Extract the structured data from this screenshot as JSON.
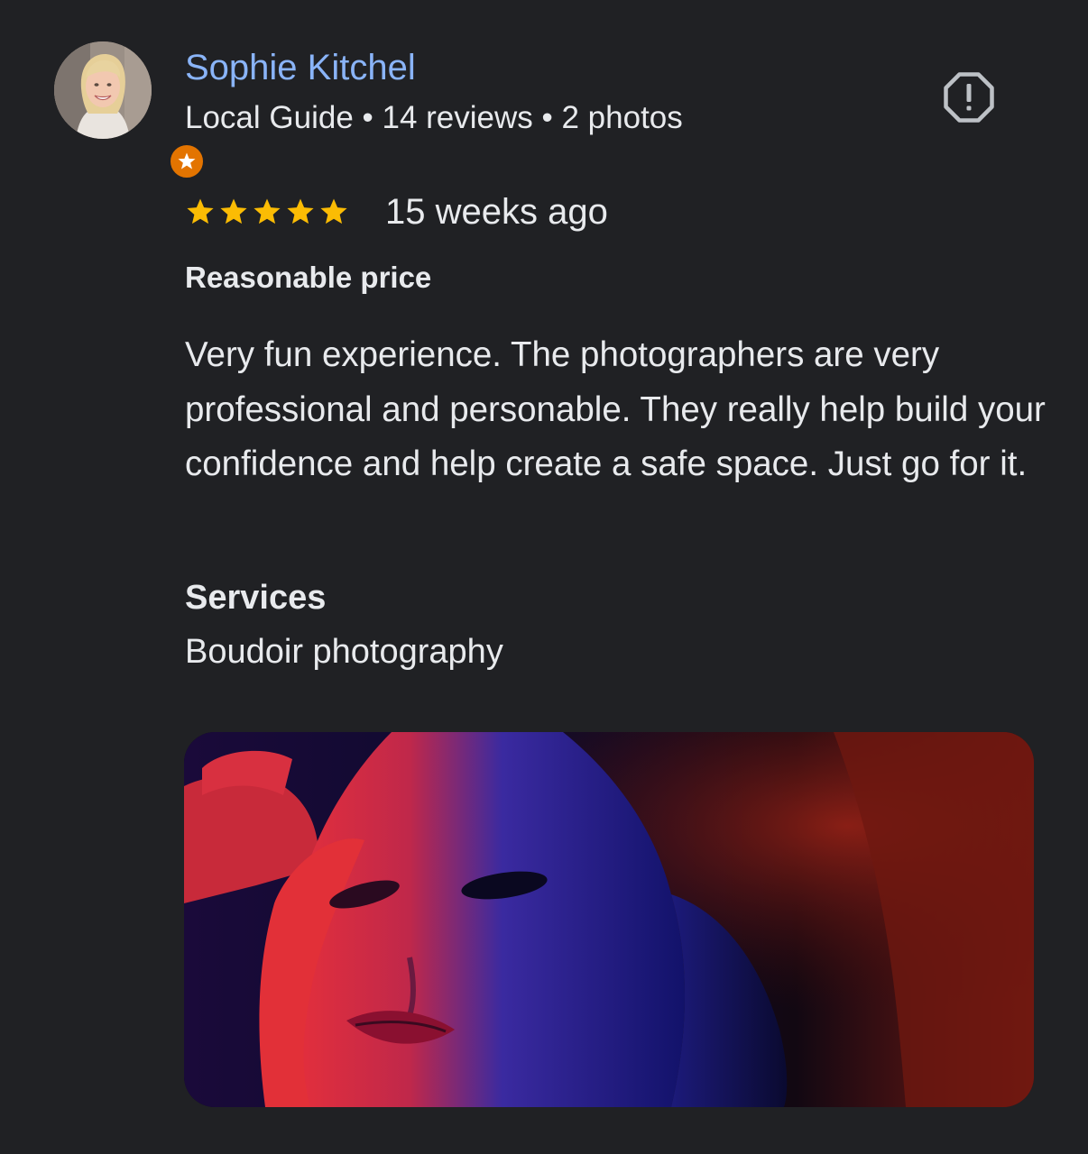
{
  "reviewer": {
    "name": "Sophie Kitchel",
    "meta": "Local Guide • 14 reviews • 2 photos",
    "badge_icon": "local-guide-star-icon"
  },
  "actions": {
    "report_icon": "report-icon"
  },
  "review": {
    "rating": 5,
    "rating_max": 5,
    "time": "15 weeks ago",
    "highlight": "Reasonable price",
    "text": "Very fun experience. The photographers are very professional and personable. They really help build your confidence and help create a safe space. Just go for it.",
    "services_title": "Services",
    "services_value": "Boudoir photography",
    "photo_icon": "review-photo"
  },
  "colors": {
    "background": "#202124",
    "name_link": "#8ab4f8",
    "text": "#e8eaed",
    "star": "#fbbc04",
    "badge": "#e37400"
  }
}
